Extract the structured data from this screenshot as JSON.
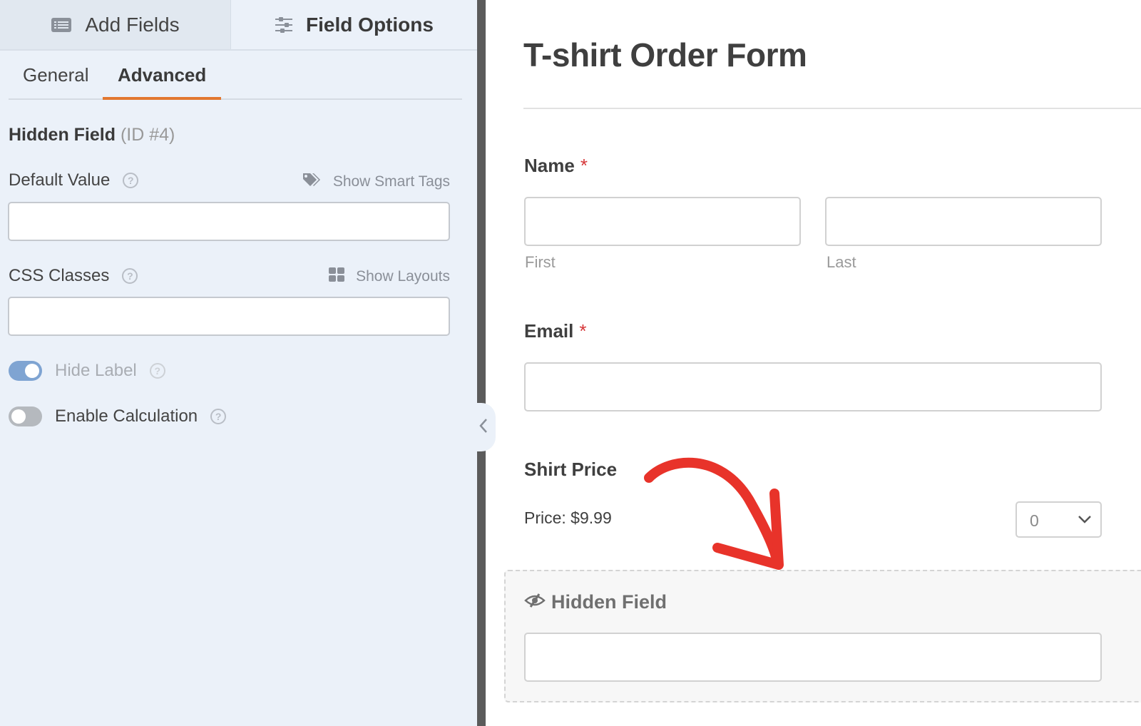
{
  "left_panel": {
    "top_tabs": [
      {
        "label": "Add Fields",
        "icon": "list-icon",
        "active": false
      },
      {
        "label": "Field Options",
        "icon": "sliders-icon",
        "active": true
      }
    ],
    "sub_tabs": [
      {
        "label": "General",
        "active": false
      },
      {
        "label": "Advanced",
        "active": true
      }
    ],
    "field_title": "Hidden Field",
    "field_id": "(ID #4)",
    "default_value": {
      "label": "Default Value",
      "help": "?",
      "link_label": "Show Smart Tags",
      "link_icon": "tags-icon",
      "value": ""
    },
    "css_classes": {
      "label": "CSS Classes",
      "help": "?",
      "link_label": "Show Layouts",
      "link_icon": "grid-icon",
      "value": ""
    },
    "toggles": [
      {
        "label": "Hide Label",
        "on": true,
        "disabled": true,
        "help": "?"
      },
      {
        "label": "Enable Calculation",
        "on": false,
        "disabled": false,
        "help": "?"
      }
    ],
    "accent_color": "#e27730"
  },
  "collapse_icon": "chevron-left-icon",
  "form": {
    "title": "T-shirt Order Form",
    "name_field": {
      "label": "Name",
      "required_mark": "*",
      "first_sublabel": "First",
      "last_sublabel": "Last",
      "first_value": "",
      "last_value": ""
    },
    "email_field": {
      "label": "Email",
      "required_mark": "*",
      "value": ""
    },
    "shirt_price": {
      "label": "Shirt Price",
      "price_text": "Price: $9.99",
      "quantity_selected": "0"
    },
    "hidden_field": {
      "label": "Hidden Field",
      "icon": "eye-slash-icon",
      "value": ""
    },
    "required_color": "#d63638",
    "annotation_arrow_color": "#e8332a"
  }
}
